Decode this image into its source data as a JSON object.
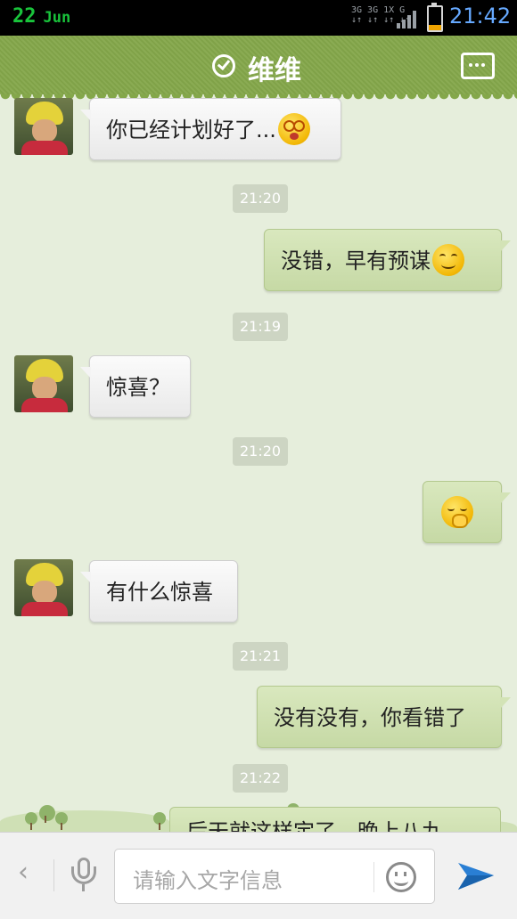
{
  "status_bar": {
    "day": "22",
    "month": "Jun",
    "network_line1": "3G 3G 1X G",
    "network_line2": "↓↑ ↓↑ ↓↑ ↓↑",
    "time": "21:42",
    "battery_level": 0.25,
    "colors": {
      "date": "#19c43b",
      "time": "#66a9ff"
    }
  },
  "header": {
    "title": "维维",
    "verified_icon": "check-circle-icon",
    "more_icon": "chat-more-icon",
    "color": "#84a74a"
  },
  "messages": [
    {
      "side": "in",
      "text": "你已经计划好了...",
      "emoji": "dizzy"
    },
    {
      "type": "time",
      "text": "21:20"
    },
    {
      "side": "out",
      "text": "没错，早有预谋",
      "emoji": "smile"
    },
    {
      "type": "time",
      "text": "21:19"
    },
    {
      "side": "in",
      "text": "惊喜？"
    },
    {
      "type": "time",
      "text": "21:20"
    },
    {
      "side": "out",
      "text": "",
      "emoji": "giggle"
    },
    {
      "side": "in",
      "text": "有什么惊喜"
    },
    {
      "type": "time",
      "text": "21:21"
    },
    {
      "side": "out",
      "text": "没有没有，你看错了"
    },
    {
      "type": "time",
      "text": "21:22"
    },
    {
      "side": "out",
      "text": "后天就这样定了，晚上八九",
      "partial": true
    }
  ],
  "input_bar": {
    "placeholder": "请输入文字信息",
    "back_icon": "chevron-left-icon",
    "voice_icon": "microphone-icon",
    "emoji_icon": "smiley-icon",
    "send_icon": "send-arrow-icon",
    "send_color": "#2a7fd4"
  }
}
